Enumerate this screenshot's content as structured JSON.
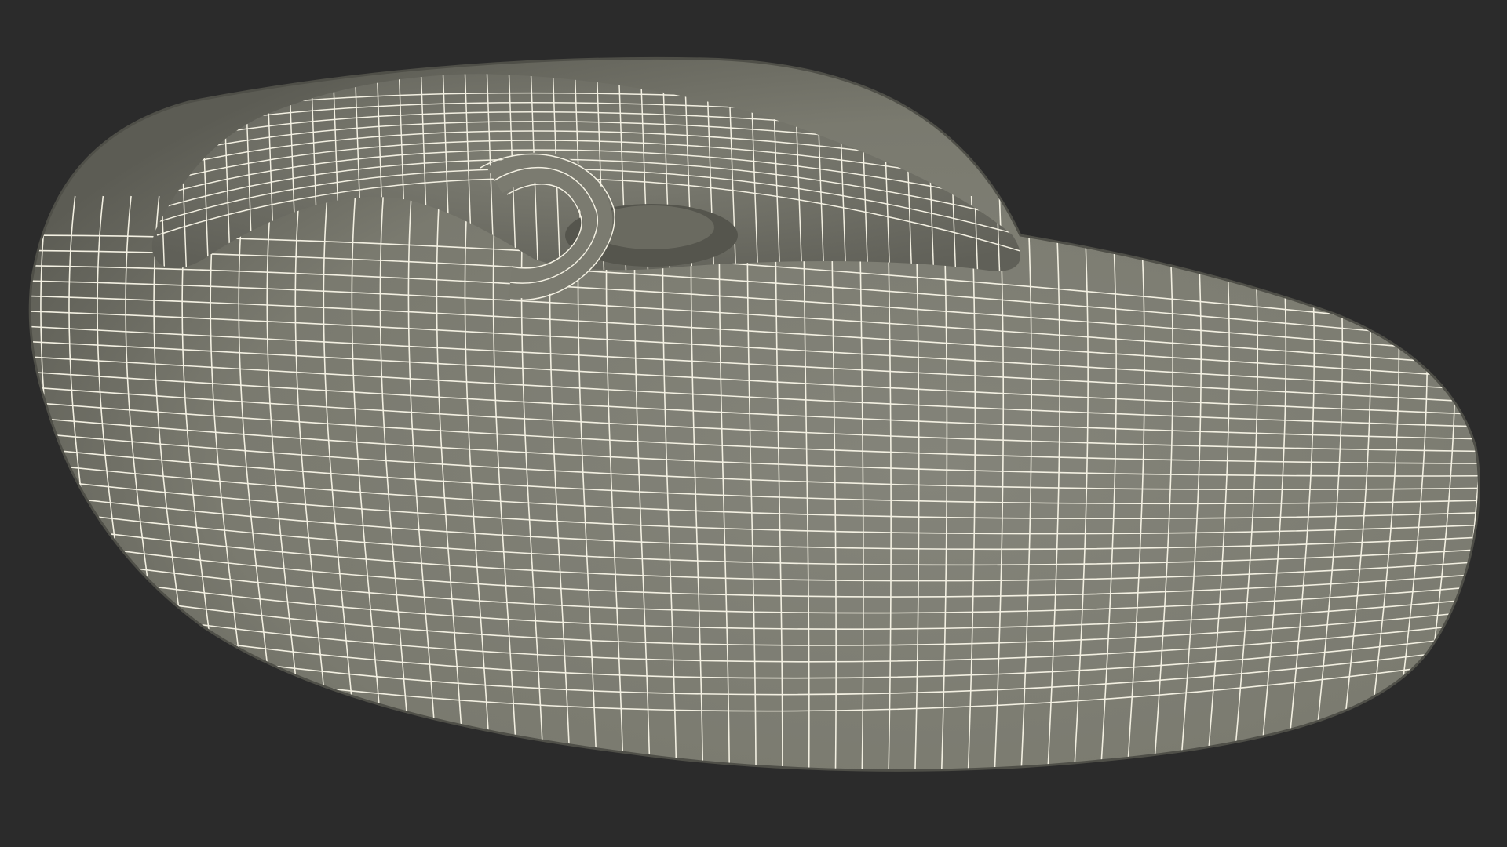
{
  "scene": {
    "subject": "wireframe-mesh-render",
    "colors": {
      "background": "#2b2b2b",
      "surface": "#7c7c70",
      "surface_shadow": "#5e5e55",
      "surface_highlight": "#8a8a7e",
      "wire": "#f3f0e2",
      "inner_shadow": "#4a4a43"
    }
  }
}
